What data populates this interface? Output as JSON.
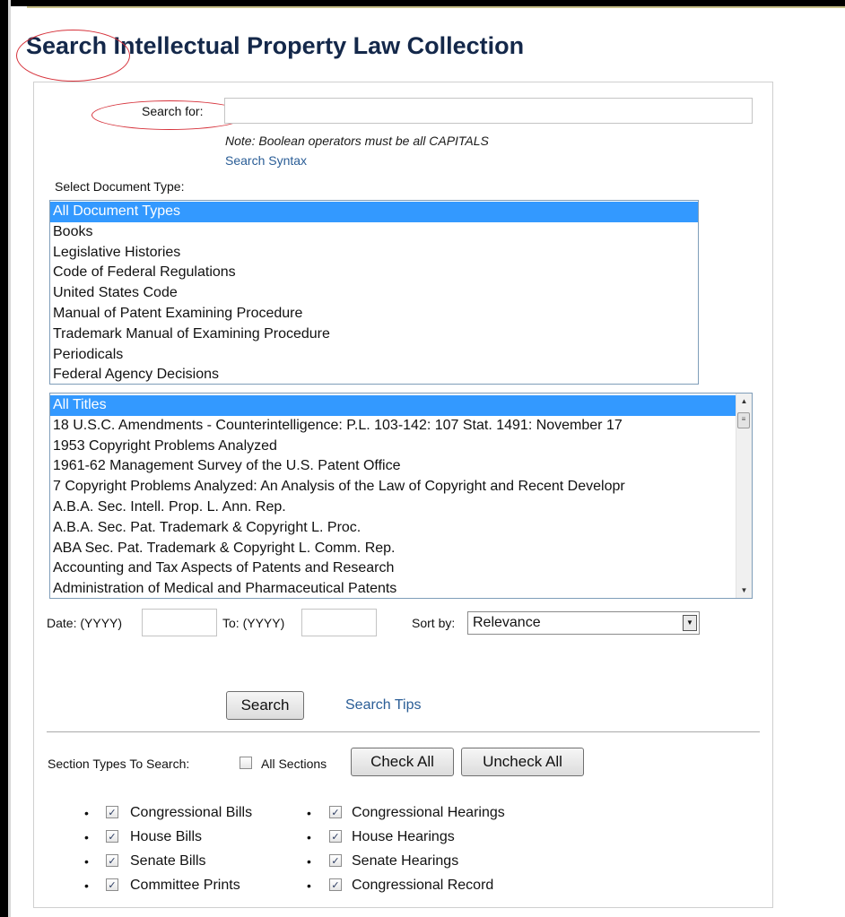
{
  "page_title": "Search Intellectual Property Law Collection",
  "search": {
    "label": "Search for:",
    "value": "",
    "note": "Note: Boolean operators must be all CAPITALS",
    "syntax_link": "Search Syntax"
  },
  "document_type": {
    "label": "Select Document Type:",
    "options": [
      {
        "label": "All Document Types",
        "selected": true
      },
      {
        "label": "Books"
      },
      {
        "label": "Legislative Histories"
      },
      {
        "label": "Code of Federal Regulations"
      },
      {
        "label": "United States Code"
      },
      {
        "label": "Manual of Patent Examining Procedure"
      },
      {
        "label": "Trademark Manual of Examining Procedure"
      },
      {
        "label": "Periodicals"
      },
      {
        "label": "Federal Agency Decisions"
      }
    ]
  },
  "titles": {
    "options": [
      {
        "label": "All Titles",
        "selected": true
      },
      {
        "label": "18 U.S.C. Amendments - Counterintelligence: P.L. 103-142: 107 Stat. 1491: November 17"
      },
      {
        "label": "1953 Copyright Problems Analyzed"
      },
      {
        "label": "1961-62 Management Survey of the U.S. Patent Office"
      },
      {
        "label": "7 Copyright Problems Analyzed: An Analysis of the Law of Copyright and Recent Developr"
      },
      {
        "label": "A.B.A. Sec. Intell. Prop. L. Ann. Rep."
      },
      {
        "label": "A.B.A. Sec. Pat. Trademark & Copyright L. Proc."
      },
      {
        "label": "ABA Sec. Pat. Trademark & Copyright L. Comm. Rep."
      },
      {
        "label": "Accounting and Tax Aspects of Patents and Research"
      },
      {
        "label": "Administration of Medical and Pharmaceutical Patents"
      }
    ]
  },
  "date": {
    "from_label": "Date: (YYYY)",
    "from_value": "",
    "to_label": "To: (YYYY)",
    "to_value": ""
  },
  "sort": {
    "label": "Sort by:",
    "value": "Relevance"
  },
  "actions": {
    "search_button": "Search",
    "tips_link": "Search Tips"
  },
  "sections": {
    "label": "Section Types To Search:",
    "all_sections_label": "All Sections",
    "all_sections_checked": false,
    "check_all": "Check All",
    "uncheck_all": "Uncheck All",
    "left": [
      {
        "label": "Congressional Bills",
        "checked": true
      },
      {
        "label": "House Bills",
        "checked": true
      },
      {
        "label": "Senate Bills",
        "checked": true
      },
      {
        "label": "Committee Prints",
        "checked": true
      }
    ],
    "right": [
      {
        "label": "Congressional Hearings",
        "checked": true
      },
      {
        "label": "House Hearings",
        "checked": true
      },
      {
        "label": "Senate Hearings",
        "checked": true
      },
      {
        "label": "Congressional Record",
        "checked": true
      }
    ]
  },
  "colors": {
    "title": "#14284a",
    "link": "#2a5d96",
    "selection": "#3399ff",
    "annotation": "#d6323b"
  }
}
